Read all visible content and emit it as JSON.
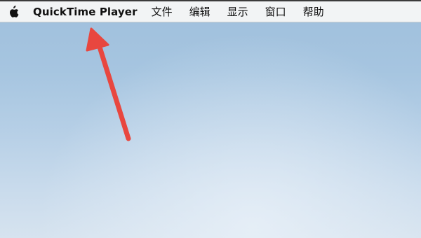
{
  "menubar": {
    "apple_icon": "apple-icon",
    "app_name": "QuickTime Player",
    "items": [
      {
        "label": "文件"
      },
      {
        "label": "编辑"
      },
      {
        "label": "显示"
      },
      {
        "label": "窗口"
      },
      {
        "label": "帮助"
      }
    ]
  },
  "annotation": {
    "type": "arrow",
    "color": "#e8473f",
    "points_to": "app-name"
  }
}
